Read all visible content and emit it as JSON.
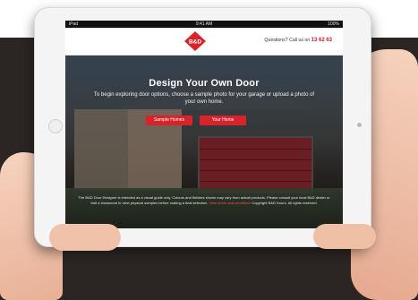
{
  "statusbar": {
    "carrier": "iPad",
    "time": "9:41 AM",
    "battery": "100%"
  },
  "header": {
    "brand": "B&D",
    "contact_label": "Questions? Call us on",
    "phone": "13 62 63"
  },
  "hero": {
    "title": "Design Your Own Door",
    "subtitle": "To begin exploring door options, choose a sample photo for your garage or upload a photo of your own home.",
    "buttons": [
      {
        "label": "Sample Homes"
      },
      {
        "label": "Your Home"
      }
    ]
  },
  "footer": {
    "disclaimer": "The B&D Door Designer is intended as a visual guide only. Colours and finishes shown may vary from actual products. Please consult your local B&D dealer or visit a showroom to view physical samples before making a final selection.",
    "link_text": "View terms and conditions",
    "note": "Copyright B&D Doors. All rights reserved."
  },
  "colors": {
    "accent": "#d8232a",
    "backdrop": "#2b2523"
  },
  "icons": {
    "logo": "bd-logo-icon",
    "home_button": "home-button-icon",
    "camera": "camera-icon"
  }
}
